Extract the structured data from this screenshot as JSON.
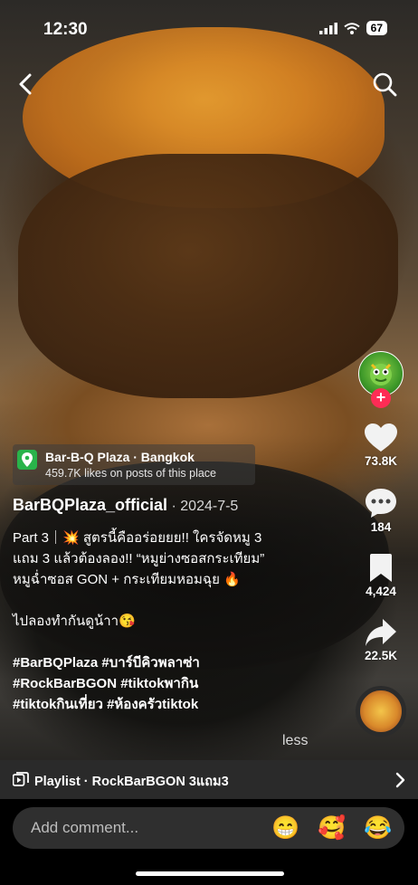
{
  "status_bar": {
    "time": "12:30",
    "battery": "67"
  },
  "location": {
    "title": "Bar-B-Q Plaza · Bangkok",
    "subtitle": "459.7K likes on posts of this place"
  },
  "author": {
    "name": "BarBQPlaza_official",
    "date": " · 2024-7-5"
  },
  "caption": {
    "line1": "Part 3｜💥 สูตรนี้คืออร่อยยย!! ใครจัดหมู 3",
    "line2": "แถม 3 แล้วต้องลอง!! “หมูย่างซอสกระเทียม”",
    "line3": "หมูฉ่ำซอส GON + กระเทียมหอมฉุย 🔥",
    "line4": "ไปลองทำกันดูน้าา😘",
    "tags1": "#BarBQPlaza #บาร์บีคิวพลาซ่า",
    "tags2": "#RockBarBGON #tiktokพากิน",
    "tags3": "#tiktokกินเที่ยว #ห้องครัวtiktok",
    "less": "less"
  },
  "actions": {
    "likes": "73.8K",
    "comments": "184",
    "saves": "4,424",
    "shares": "22.5K"
  },
  "playlist": {
    "label": "Playlist · RockBarBGON 3แถม3"
  },
  "comment_bar": {
    "placeholder": "Add comment...",
    "emojis": [
      "😁",
      "🥰",
      "😂"
    ]
  },
  "colors": {
    "accent": "#fe2c55",
    "location_icon": "#29b34a",
    "playlist_bar": "#2a2a2a"
  }
}
